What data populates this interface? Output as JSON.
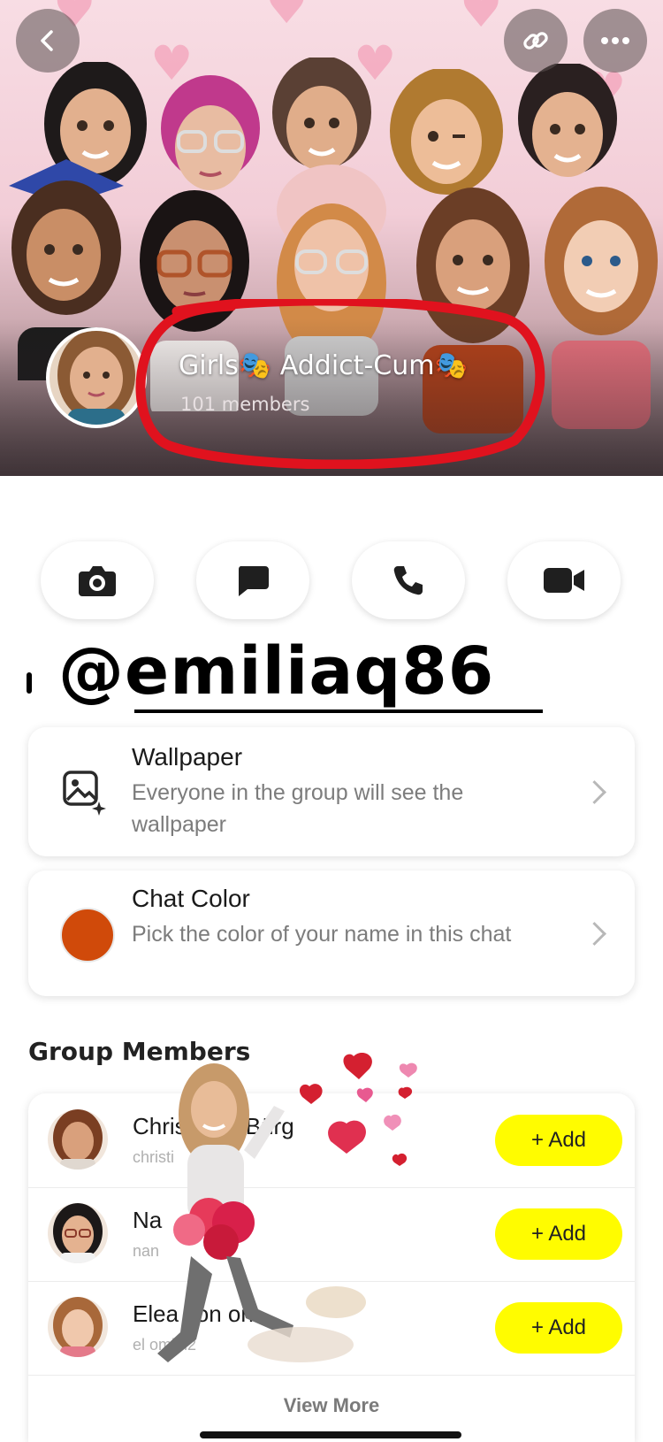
{
  "header": {
    "back_icon": "chevron-left-icon",
    "link_icon": "link-icon",
    "more_icon": "ellipsis-icon",
    "group_name": "Girls🎭 Addict-Cum🎭",
    "member_count": "101 members"
  },
  "actions": [
    {
      "icon": "camera-icon"
    },
    {
      "icon": "chat-icon"
    },
    {
      "icon": "phone-icon"
    },
    {
      "icon": "video-icon"
    }
  ],
  "overlay": {
    "handle": "@emiliaq86"
  },
  "settings": {
    "wallpaper": {
      "title": "Wallpaper",
      "description": "Everyone in the group will see the wallpaper",
      "icon": "wallpaper-icon"
    },
    "chat_color": {
      "title": "Chat Color",
      "description": "Pick the color of your name in this chat",
      "swatch_color": "#d04a0a"
    }
  },
  "members_section": {
    "title": "Group Members",
    "members": [
      {
        "name": "Christin🍔 Bürg",
        "username": "christi",
        "add_label": "+ Add"
      },
      {
        "name": "Na",
        "username": "nan",
        "add_label": "+ Add"
      },
      {
        "name": "Elea Ton on",
        "username": "el omlin2",
        "add_label": "+ Add"
      }
    ],
    "view_more": "View More"
  },
  "colors": {
    "add_yellow": "#fffc00",
    "annotation_red": "#e0121e"
  }
}
